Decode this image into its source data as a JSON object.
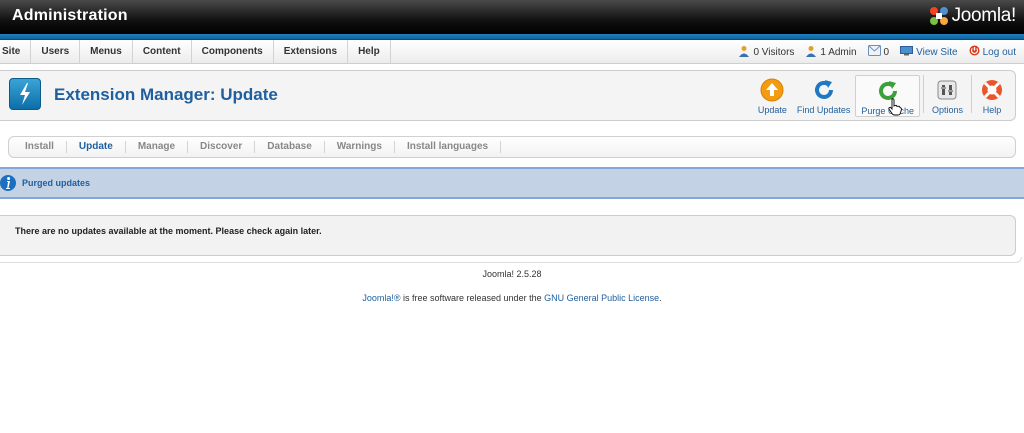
{
  "header": {
    "title": "Administration",
    "logo_text": "Joomla!"
  },
  "menu": [
    {
      "label": "Site"
    },
    {
      "label": "Users"
    },
    {
      "label": "Menus"
    },
    {
      "label": "Content"
    },
    {
      "label": "Components"
    },
    {
      "label": "Extensions"
    },
    {
      "label": "Help"
    }
  ],
  "status": {
    "visitors": "0 Visitors",
    "admins": "1 Admin",
    "messages": "0",
    "view_site": "View Site",
    "logout": "Log out"
  },
  "page": {
    "title": "Extension Manager: Update"
  },
  "toolbar": {
    "update": "Update",
    "find_updates": "Find Updates",
    "purge_cache": "Purge Cache",
    "options": "Options",
    "help": "Help"
  },
  "submenu": [
    {
      "label": "Install"
    },
    {
      "label": "Update"
    },
    {
      "label": "Manage"
    },
    {
      "label": "Discover"
    },
    {
      "label": "Database"
    },
    {
      "label": "Warnings"
    },
    {
      "label": "Install languages"
    }
  ],
  "message": {
    "text": "Purged updates"
  },
  "content": {
    "text": "There are no updates available at the moment. Please check again later."
  },
  "footer": {
    "version": "Joomla! 2.5.28",
    "brand": "Joomla!®",
    "license_middle": " is free software released under the ",
    "license_link": "GNU General Public License",
    "license_end": "."
  },
  "colors": {
    "accent": "#1f5f9e",
    "message_bg": "#c3d2e5",
    "header_stripe": "#1e80c0"
  }
}
